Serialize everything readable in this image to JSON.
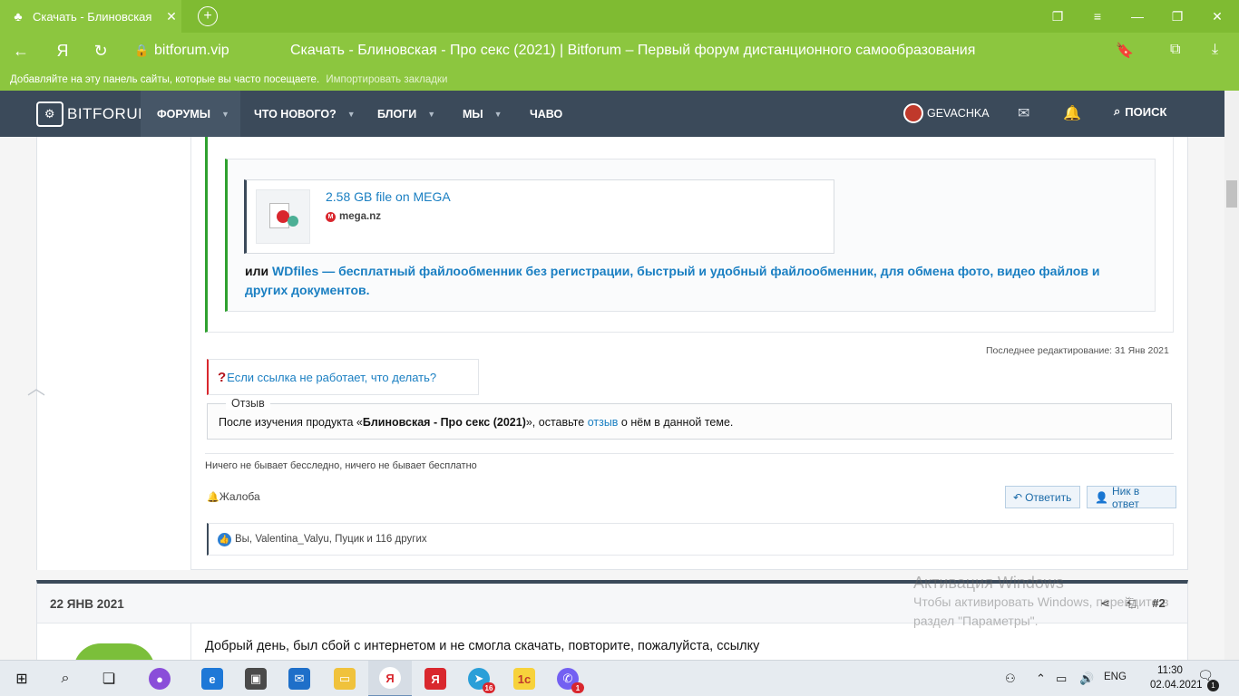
{
  "browser": {
    "tab_title": "Скачать - Блиновская",
    "host": "bitforum.vip",
    "page_title": "Скачать - Блиновская - Про секс (2021) | Bitforum – Первый форум дистанционного самообразования",
    "bookmarks_hint": "Добавляйте на эту панель сайты, которые вы часто посещаете.",
    "bookmarks_import": "Импортировать закладки",
    "yandex_glyph": "Я"
  },
  "site": {
    "logo_text": "BITFORUM",
    "nav": [
      {
        "label": "ФОРУМЫ"
      },
      {
        "label": "ЧТО НОВОГО?"
      },
      {
        "label": "БЛОГИ"
      },
      {
        "label": "МЫ"
      },
      {
        "label": "ЧАВО"
      }
    ],
    "username": "GEVACHKA",
    "search_label": "ПОИСК"
  },
  "post1": {
    "embed_title": "2.58 GB file on MEGA",
    "embed_site": "mega.nz",
    "or_prefix": "или ",
    "or_link": "WDfiles — бесплатный файлообменник без регистрации, быстрый и удобный файлообменник, для обмена фото, видео файлов и других документов.",
    "last_edit": "Последнее редактирование: 31 Янв 2021",
    "help_link": "Если ссылка не работает, что делать?",
    "review_legend": "Отзыв",
    "review_prefix": "После изучения продукта «",
    "review_product": "Блиновская - Про секс (2021)",
    "review_middle": "», оставьте ",
    "review_link": "отзыв",
    "review_suffix": " о нём в данной теме.",
    "signature": "Ничего не бывает бесследно, ничего не бывает бесплатно",
    "report_label": "Жалоба",
    "reply_label": "Ответить",
    "mention_label": "Ник в ответ",
    "likes_text": "Вы, Valentina_Valyu, Пуцик и 116 других"
  },
  "post2": {
    "date": "22 ЯНВ 2021",
    "number": "#2",
    "body": "Добрый день, был сбой с интернетом и не смогла скачать, повторите, пожалуйста, ссылку"
  },
  "watermark": {
    "title": "Активация Windows",
    "line1": "Чтобы активировать Windows, перейдите в",
    "line2": "раздел \"Параметры\"."
  },
  "taskbar": {
    "lang": "ENG",
    "time": "11:30",
    "date": "02.04.2021",
    "telegram_badge": "16",
    "viber_badge": "1",
    "notif_count": "1",
    "yandex_glyph": "Я",
    "onec_glyph": "1с"
  }
}
